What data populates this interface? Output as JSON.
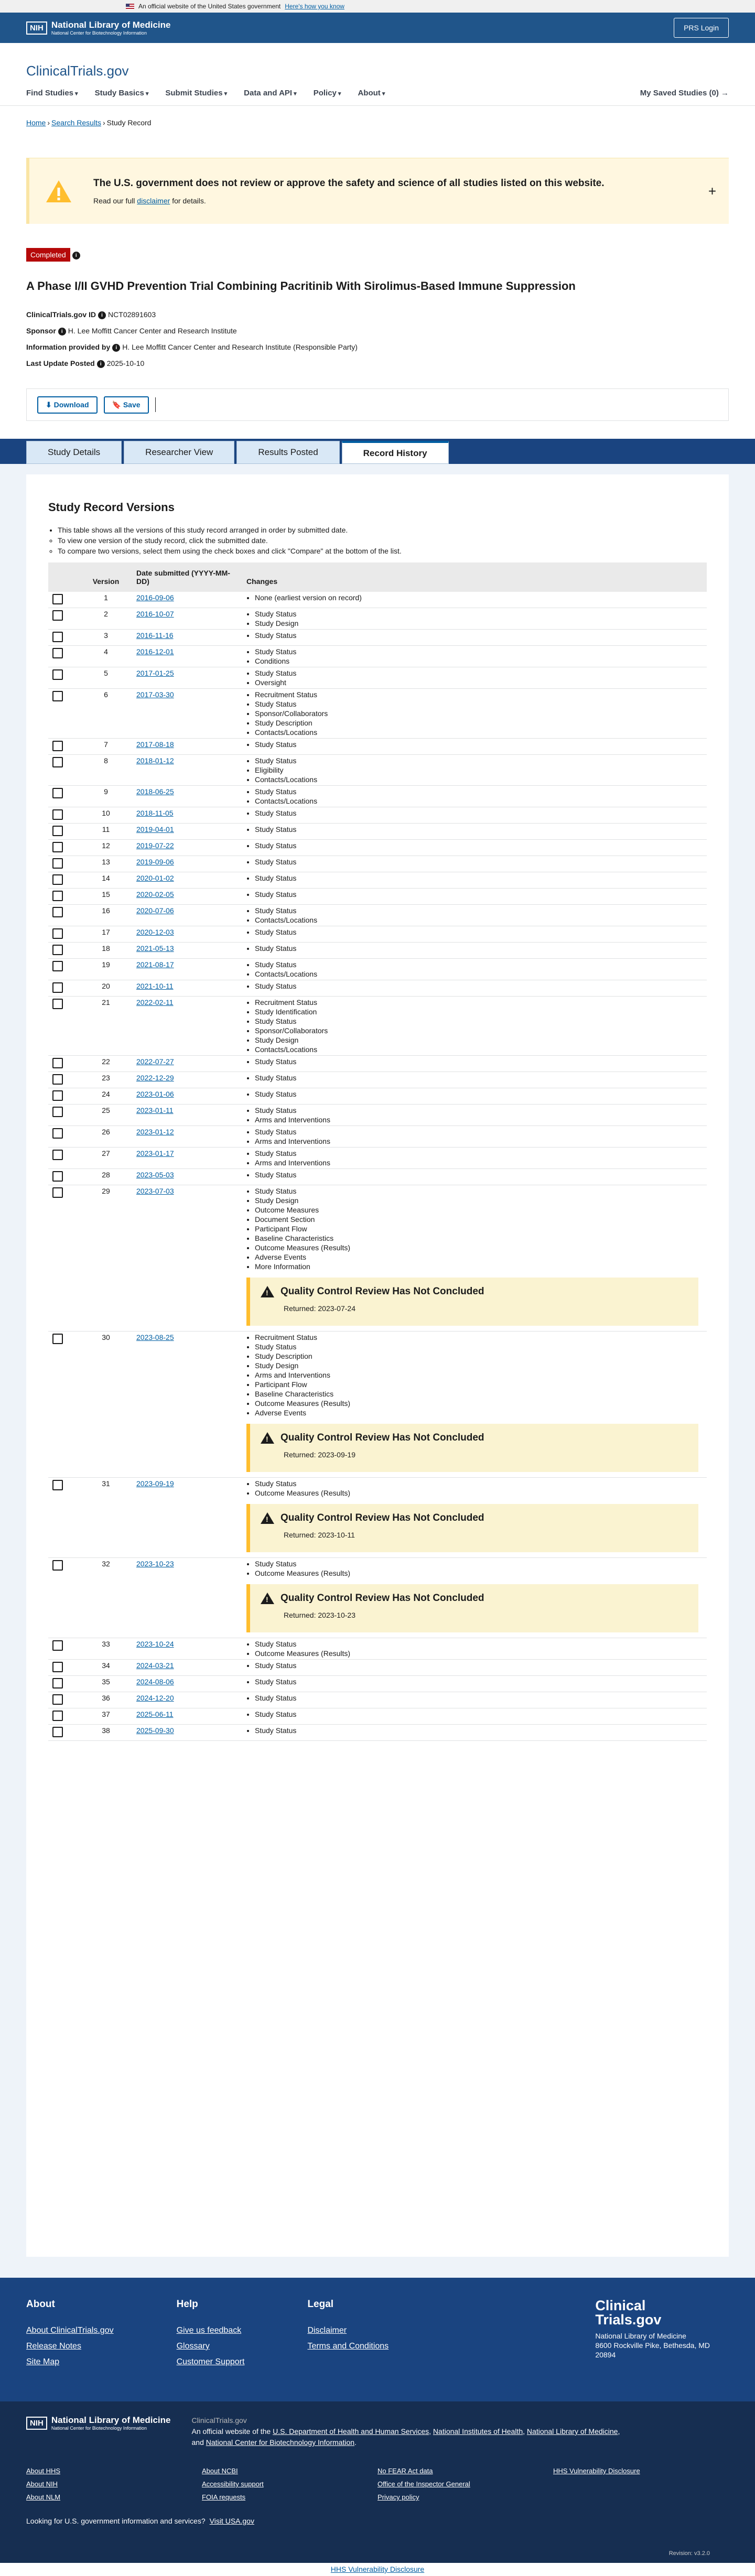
{
  "gov_banner": {
    "text": "An official website of the United States government",
    "link": "Here's how you know"
  },
  "nlm_bar": {
    "nih": "NIH",
    "org_name": "National Library of Medicine",
    "org_sub": "National Center for Biotechnology Information",
    "prs_login": "PRS Login"
  },
  "brand": {
    "name": "ClinicalTrials",
    "suffix": ".gov"
  },
  "nav": {
    "items": [
      "Find Studies",
      "Study Basics",
      "Submit Studies",
      "Data and API",
      "Policy",
      "About"
    ],
    "saved": "My Saved Studies (0) →"
  },
  "breadcrumb": {
    "home": "Home",
    "search": "Search Results",
    "current": "Study Record"
  },
  "notice": {
    "title": "The U.S. government does not review or approve the safety and science of all studies listed on this website.",
    "text_before": "Read our full",
    "link": "disclaimer",
    "text_after": "for details.",
    "expand": "+"
  },
  "study": {
    "status": "Completed",
    "title": "A Phase I/II GVHD Prevention Trial Combining Pacritinib With Sirolimus-Based Immune Suppression",
    "id_label": "ClinicalTrials.gov ID",
    "id_value": "NCT02891603",
    "sponsor_label": "Sponsor",
    "sponsor_value": "H. Lee Moffitt Cancer Center and Research Institute",
    "info_label": "Information provided by",
    "info_value": "H. Lee Moffitt Cancer Center and Research Institute (Responsible Party)",
    "update_label": "Last Update Posted",
    "update_value": "2025-10-10"
  },
  "actions": {
    "download": "Download",
    "save": "Save"
  },
  "tabs": [
    "Study Details",
    "Researcher View",
    "Results Posted",
    "Record History"
  ],
  "history": {
    "heading": "Study Record Versions",
    "intro": "This table shows all the versions of this study record arranged in order by submitted date.",
    "tip1": "To view one version of the study record, click the submitted date.",
    "tip2": "To compare two versions, select them using the check boxes and click \"Compare\" at the bottom of the list.",
    "col_version": "Version",
    "col_date": "Date submitted (YYYY-MM-DD)",
    "col_changes": "Changes",
    "qc_title": "Quality Control Review Has Not Concluded",
    "qc_returned": "Returned:",
    "rows": [
      {
        "v": "1",
        "date": "2016-09-06",
        "changes": [
          "None (earliest version on record)"
        ]
      },
      {
        "v": "2",
        "date": "2016-10-07",
        "changes": [
          "Study Status",
          "Study Design"
        ]
      },
      {
        "v": "3",
        "date": "2016-11-16",
        "changes": [
          "Study Status"
        ]
      },
      {
        "v": "4",
        "date": "2016-12-01",
        "changes": [
          "Study Status",
          "Conditions"
        ]
      },
      {
        "v": "5",
        "date": "2017-01-25",
        "changes": [
          "Study Status",
          "Oversight"
        ]
      },
      {
        "v": "6",
        "date": "2017-03-30",
        "changes": [
          "Recruitment Status",
          "Study Status",
          "Sponsor/Collaborators",
          "Study Description",
          "Contacts/Locations"
        ]
      },
      {
        "v": "7",
        "date": "2017-08-18",
        "changes": [
          "Study Status"
        ]
      },
      {
        "v": "8",
        "date": "2018-01-12",
        "changes": [
          "Study Status",
          "Eligibility",
          "Contacts/Locations"
        ]
      },
      {
        "v": "9",
        "date": "2018-06-25",
        "changes": [
          "Study Status",
          "Contacts/Locations"
        ]
      },
      {
        "v": "10",
        "date": "2018-11-05",
        "changes": [
          "Study Status"
        ]
      },
      {
        "v": "11",
        "date": "2019-04-01",
        "changes": [
          "Study Status"
        ]
      },
      {
        "v": "12",
        "date": "2019-07-22",
        "changes": [
          "Study Status"
        ]
      },
      {
        "v": "13",
        "date": "2019-09-06",
        "changes": [
          "Study Status"
        ]
      },
      {
        "v": "14",
        "date": "2020-01-02",
        "changes": [
          "Study Status"
        ]
      },
      {
        "v": "15",
        "date": "2020-02-05",
        "changes": [
          "Study Status"
        ]
      },
      {
        "v": "16",
        "date": "2020-07-06",
        "changes": [
          "Study Status",
          "Contacts/Locations"
        ]
      },
      {
        "v": "17",
        "date": "2020-12-03",
        "changes": [
          "Study Status"
        ]
      },
      {
        "v": "18",
        "date": "2021-05-13",
        "changes": [
          "Study Status"
        ]
      },
      {
        "v": "19",
        "date": "2021-08-17",
        "changes": [
          "Study Status",
          "Contacts/Locations"
        ]
      },
      {
        "v": "20",
        "date": "2021-10-11",
        "changes": [
          "Study Status"
        ]
      },
      {
        "v": "21",
        "date": "2022-02-11",
        "changes": [
          "Recruitment Status",
          "Study Identification",
          "Study Status",
          "Sponsor/Collaborators",
          "Study Design",
          "Contacts/Locations"
        ]
      },
      {
        "v": "22",
        "date": "2022-07-27",
        "changes": [
          "Study Status"
        ]
      },
      {
        "v": "23",
        "date": "2022-12-29",
        "changes": [
          "Study Status"
        ]
      },
      {
        "v": "24",
        "date": "2023-01-06",
        "changes": [
          "Study Status"
        ]
      },
      {
        "v": "25",
        "date": "2023-01-11",
        "changes": [
          "Study Status",
          "Arms and Interventions"
        ]
      },
      {
        "v": "26",
        "date": "2023-01-12",
        "changes": [
          "Study Status",
          "Arms and Interventions"
        ]
      },
      {
        "v": "27",
        "date": "2023-01-17",
        "changes": [
          "Study Status",
          "Arms and Interventions"
        ]
      },
      {
        "v": "28",
        "date": "2023-05-03",
        "changes": [
          "Study Status"
        ]
      },
      {
        "v": "29",
        "date": "2023-07-03",
        "changes": [
          "Study Status",
          "Study Design",
          "Outcome Measures",
          "Document Section",
          "Participant Flow",
          "Baseline Characteristics",
          "Outcome Measures (Results)",
          "Adverse Events",
          "More Information"
        ],
        "qc": "2023-07-24"
      },
      {
        "v": "30",
        "date": "2023-08-25",
        "changes": [
          "Recruitment Status",
          "Study Status",
          "Study Description",
          "Study Design",
          "Arms and Interventions",
          "Participant Flow",
          "Baseline Characteristics",
          "Outcome Measures (Results)",
          "Adverse Events"
        ],
        "qc": "2023-09-19"
      },
      {
        "v": "31",
        "date": "2023-09-19",
        "changes": [
          "Study Status",
          "Outcome Measures (Results)"
        ],
        "qc": "2023-10-11"
      },
      {
        "v": "32",
        "date": "2023-10-23",
        "changes": [
          "Study Status",
          "Outcome Measures (Results)"
        ],
        "qc": "2023-10-23"
      },
      {
        "v": "33",
        "date": "2023-10-24",
        "changes": [
          "Study Status",
          "Outcome Measures (Results)"
        ]
      },
      {
        "v": "34",
        "date": "2024-03-21",
        "changes": [
          "Study Status"
        ]
      },
      {
        "v": "35",
        "date": "2024-08-06",
        "changes": [
          "Study Status"
        ]
      },
      {
        "v": "36",
        "date": "2024-12-20",
        "changes": [
          "Study Status"
        ]
      },
      {
        "v": "37",
        "date": "2025-06-11",
        "changes": [
          "Study Status"
        ]
      },
      {
        "v": "38",
        "date": "2025-09-30",
        "changes": [
          "Study Status"
        ]
      }
    ]
  },
  "footer": {
    "about": {
      "title": "About",
      "links": [
        "About ClinicalTrials.gov",
        "Release Notes",
        "Site Map"
      ]
    },
    "help": {
      "title": "Help",
      "links": [
        "Give us feedback",
        "Glossary",
        "Customer Support"
      ]
    },
    "legal": {
      "title": "Legal",
      "links": [
        "Disclaimer",
        "Terms and Conditions"
      ]
    },
    "brand1": "Clinical",
    "brand2": "Trials.gov",
    "org": "National Library of Medicine",
    "addr1": "8600 Rockville Pike, Bethesda, MD",
    "addr2": "20894"
  },
  "nlm_footer": {
    "site": "ClinicalTrials.gov",
    "official_before": "An official website of the",
    "hhs": "U.S. Department of Health and Human Services",
    "nih": "National Institutes of Health",
    "nlm": "National Library of Medicine",
    "and": "and",
    "ncbi": "National Center for Biotechnology Information",
    "col1": [
      "About HHS",
      "About NIH",
      "About NLM"
    ],
    "col2": [
      "About NCBI",
      "Accessibility support",
      "FOIA requests"
    ],
    "col3": [
      "No FEAR Act data",
      "Office of the Inspector General",
      "Privacy policy"
    ],
    "col4": [
      "HHS Vulnerability Disclosure"
    ],
    "usa_text": "Looking for U.S. government information and services?",
    "usa_link": "Visit USA.gov",
    "revision": "Revision: v3.2.0"
  },
  "bottom_link": "HHS Vulnerability Disclosure"
}
